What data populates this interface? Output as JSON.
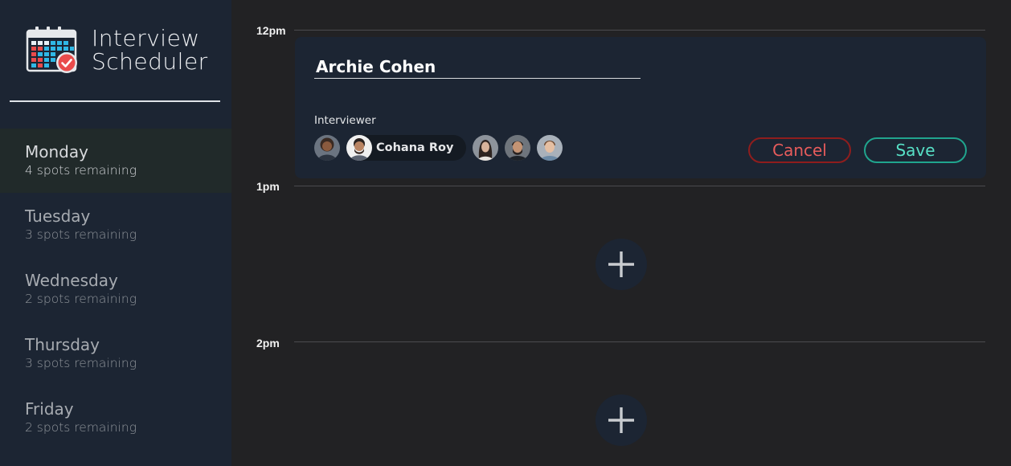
{
  "app": {
    "title_line1": "Interview",
    "title_line2": "Scheduler",
    "logo_icon": "calendar-check-icon"
  },
  "days": [
    {
      "name": "Monday",
      "spots": "4 spots remaining",
      "selected": true
    },
    {
      "name": "Tuesday",
      "spots": "3 spots remaining",
      "selected": false
    },
    {
      "name": "Wednesday",
      "spots": "2 spots remaining",
      "selected": false
    },
    {
      "name": "Thursday",
      "spots": "3 spots remaining",
      "selected": false
    },
    {
      "name": "Friday",
      "spots": "2 spots remaining",
      "selected": false
    }
  ],
  "schedule": {
    "times": [
      "12pm",
      "1pm",
      "2pm"
    ],
    "form": {
      "student_name": "Archie Cohen",
      "interviewer_label": "Interviewer",
      "selected_interviewer": "Cohana Roy",
      "cancel_label": "Cancel",
      "save_label": "Save"
    },
    "add_icon": "plus-icon"
  },
  "colors": {
    "sidebar_bg": "#1c2533",
    "page_bg": "#222224",
    "cancel": "#e85c5c",
    "save": "#57e0c6"
  }
}
